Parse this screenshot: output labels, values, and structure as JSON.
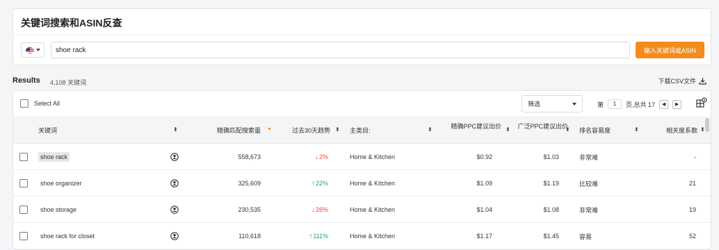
{
  "search": {
    "title": "关键词搜索和ASIN反查",
    "query": "shoe rack",
    "button_label": "输入关键词或ASIN",
    "country_icon": "us-flag-icon"
  },
  "results": {
    "label": "Results",
    "count": "4,108 关键词",
    "download_label": "下载CSV文件"
  },
  "toolbar": {
    "select_all": "Select All",
    "filter_label": "筛选",
    "page_prefix": "第",
    "page_current": "1",
    "page_suffix": "页,总共 17"
  },
  "columns": {
    "keyword": "关键词",
    "exact_volume": "精确匹配搜索量",
    "trend": "过去30天趋势",
    "category": "主类目:",
    "exact_ppc": "精确PPC建议出价",
    "broad_ppc": "广泛PPC建议出价",
    "difficulty": "排名容易度",
    "relevance": "相关度系数"
  },
  "rows": [
    {
      "keyword": "shoe rack",
      "volume": "558,673",
      "trend": "2%",
      "trend_dir": "down",
      "category": "Home & Kitchen",
      "exact_ppc": "$0.92",
      "broad_ppc": "$1.03",
      "difficulty": "非常难",
      "relevance": "-"
    },
    {
      "keyword": "shoe organizer",
      "volume": "325,609",
      "trend": "22%",
      "trend_dir": "up",
      "category": "Home & Kitchen",
      "exact_ppc": "$1.09",
      "broad_ppc": "$1.19",
      "difficulty": "比较难",
      "relevance": "21"
    },
    {
      "keyword": "shoe storage",
      "volume": "230,535",
      "trend": "26%",
      "trend_dir": "down",
      "category": "Home & Kitchen",
      "exact_ppc": "$1.04",
      "broad_ppc": "$1.08",
      "difficulty": "非常难",
      "relevance": "19"
    },
    {
      "keyword": "shoe rack for closet",
      "volume": "110,618",
      "trend": "111%",
      "trend_dir": "up",
      "category": "Home & Kitchen",
      "exact_ppc": "$1.17",
      "broad_ppc": "$1.45",
      "difficulty": "容易",
      "relevance": "52"
    }
  ],
  "colors": {
    "accent": "#f28c1c",
    "trend_up": "#1ea36b",
    "trend_down": "#d9484b"
  }
}
